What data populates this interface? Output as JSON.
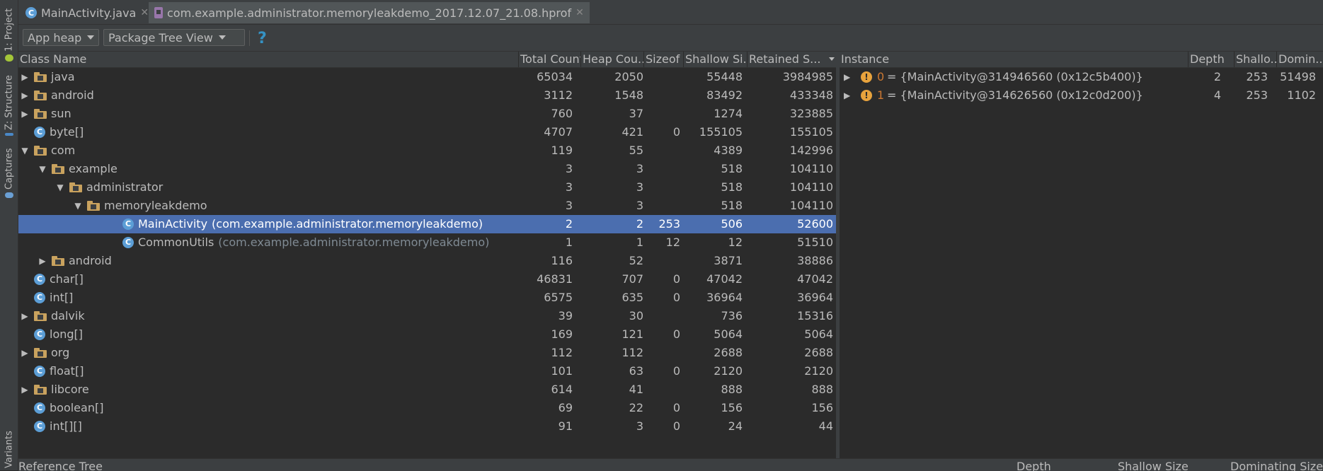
{
  "side_panel": {
    "tabs": [
      {
        "label": "1: Project",
        "icon": "android-icon"
      },
      {
        "label": "Z: Structure",
        "icon": "structure-icon"
      },
      {
        "label": "Captures",
        "icon": "captures-icon"
      },
      {
        "label": "Variants",
        "icon": "variants-icon"
      }
    ]
  },
  "editor_tabs": [
    {
      "label": "MainActivity.java",
      "icon": "class-icon"
    },
    {
      "label": "com.example.administrator.memoryleakdemo_2017.12.07_21.08.hprof",
      "icon": "hprof-file-icon"
    }
  ],
  "toolbar": {
    "heap_select": "App heap",
    "view_select": "Package Tree View",
    "help_icon": "?"
  },
  "class_table": {
    "columns": [
      "Class Name",
      "Total Count",
      "Heap Cou...",
      "Sizeof",
      "Shallow Si...",
      "Retained S..."
    ],
    "rows": [
      {
        "name": "java",
        "pkg": "",
        "type": "package",
        "depth": 0,
        "expander": "▶",
        "total": "65034",
        "heap": "2050",
        "sizeof": "",
        "shallow": "55448",
        "retained": "3984985"
      },
      {
        "name": "android",
        "pkg": "",
        "type": "package",
        "depth": 0,
        "expander": "▶",
        "total": "3112",
        "heap": "1548",
        "sizeof": "",
        "shallow": "83492",
        "retained": "433348"
      },
      {
        "name": "sun",
        "pkg": "",
        "type": "package",
        "depth": 0,
        "expander": "▶",
        "total": "760",
        "heap": "37",
        "sizeof": "",
        "shallow": "1274",
        "retained": "323885"
      },
      {
        "name": "byte[]",
        "pkg": "",
        "type": "class",
        "depth": 0,
        "expander": "",
        "total": "4707",
        "heap": "421",
        "sizeof": "0",
        "shallow": "155105",
        "retained": "155105"
      },
      {
        "name": "com",
        "pkg": "",
        "type": "package",
        "depth": 0,
        "expander": "▼",
        "total": "119",
        "heap": "55",
        "sizeof": "",
        "shallow": "4389",
        "retained": "142996"
      },
      {
        "name": "example",
        "pkg": "",
        "type": "package",
        "depth": 1,
        "expander": "▼",
        "total": "3",
        "heap": "3",
        "sizeof": "",
        "shallow": "518",
        "retained": "104110"
      },
      {
        "name": "administrator",
        "pkg": "",
        "type": "package",
        "depth": 2,
        "expander": "▼",
        "total": "3",
        "heap": "3",
        "sizeof": "",
        "shallow": "518",
        "retained": "104110"
      },
      {
        "name": "memoryleakdemo",
        "pkg": "",
        "type": "package",
        "depth": 3,
        "expander": "▼",
        "total": "3",
        "heap": "3",
        "sizeof": "",
        "shallow": "518",
        "retained": "104110"
      },
      {
        "name": "MainActivity",
        "pkg": "(com.example.administrator.memoryleakdemo)",
        "type": "class",
        "depth": 5,
        "expander": "",
        "selected": true,
        "total": "2",
        "heap": "2",
        "sizeof": "253",
        "shallow": "506",
        "retained": "52600"
      },
      {
        "name": "CommonUtils",
        "pkg": "(com.example.administrator.memoryleakdemo)",
        "type": "class",
        "depth": 5,
        "expander": "",
        "total": "1",
        "heap": "1",
        "sizeof": "12",
        "shallow": "12",
        "retained": "51510"
      },
      {
        "name": "android",
        "pkg": "",
        "type": "package",
        "depth": 1,
        "expander": "▶",
        "total": "116",
        "heap": "52",
        "sizeof": "",
        "shallow": "3871",
        "retained": "38886"
      },
      {
        "name": "char[]",
        "pkg": "",
        "type": "class",
        "depth": 0,
        "expander": "",
        "total": "46831",
        "heap": "707",
        "sizeof": "0",
        "shallow": "47042",
        "retained": "47042"
      },
      {
        "name": "int[]",
        "pkg": "",
        "type": "class",
        "depth": 0,
        "expander": "",
        "total": "6575",
        "heap": "635",
        "sizeof": "0",
        "shallow": "36964",
        "retained": "36964"
      },
      {
        "name": "dalvik",
        "pkg": "",
        "type": "package",
        "depth": 0,
        "expander": "▶",
        "total": "39",
        "heap": "30",
        "sizeof": "",
        "shallow": "736",
        "retained": "15316"
      },
      {
        "name": "long[]",
        "pkg": "",
        "type": "class",
        "depth": 0,
        "expander": "",
        "total": "169",
        "heap": "121",
        "sizeof": "0",
        "shallow": "5064",
        "retained": "5064"
      },
      {
        "name": "org",
        "pkg": "",
        "type": "package",
        "depth": 0,
        "expander": "▶",
        "total": "112",
        "heap": "112",
        "sizeof": "",
        "shallow": "2688",
        "retained": "2688"
      },
      {
        "name": "float[]",
        "pkg": "",
        "type": "class",
        "depth": 0,
        "expander": "",
        "total": "101",
        "heap": "63",
        "sizeof": "0",
        "shallow": "2120",
        "retained": "2120"
      },
      {
        "name": "libcore",
        "pkg": "",
        "type": "package",
        "depth": 0,
        "expander": "▶",
        "total": "614",
        "heap": "41",
        "sizeof": "",
        "shallow": "888",
        "retained": "888"
      },
      {
        "name": "boolean[]",
        "pkg": "",
        "type": "class",
        "depth": 0,
        "expander": "",
        "total": "69",
        "heap": "22",
        "sizeof": "0",
        "shallow": "156",
        "retained": "156"
      },
      {
        "name": "int[][]",
        "pkg": "",
        "type": "class",
        "depth": 0,
        "expander": "",
        "total": "91",
        "heap": "3",
        "sizeof": "0",
        "shallow": "24",
        "retained": "44"
      }
    ]
  },
  "instance_table": {
    "columns": [
      "Instance",
      "Depth",
      "Shallo...",
      "Domin..."
    ],
    "rows": [
      {
        "expander": "▶",
        "index": "0",
        "text": "= {MainActivity@314946560 (0x12c5b400)}",
        "depth": "2",
        "shallow": "253",
        "dominating": "51498"
      },
      {
        "expander": "▶",
        "index": "1",
        "text": "= {MainActivity@314626560 (0x12c0d200)}",
        "depth": "4",
        "shallow": "253",
        "dominating": "1102"
      }
    ]
  },
  "reference_tree": {
    "title": "Reference Tree",
    "columns": [
      "Depth",
      "Shallow Size",
      "Dominating Size"
    ]
  },
  "colors": {
    "background": "#2b2b2b",
    "panel": "#3c3f41",
    "selection": "#4b6eaf",
    "folder": "#c9a25e",
    "class_icon": "#5c9ed6",
    "warning": "#e8a33d",
    "help": "#3592c4"
  }
}
